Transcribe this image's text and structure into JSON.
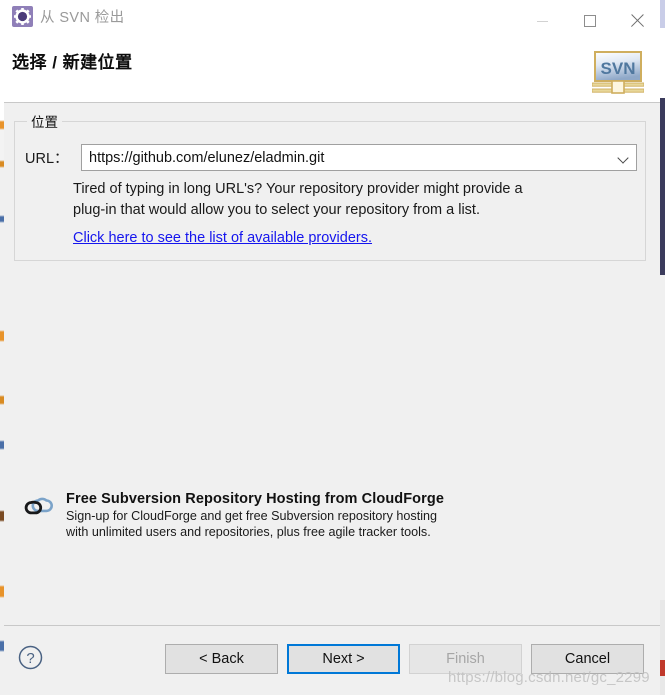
{
  "window": {
    "title": "从 SVN 检出",
    "app_icon": "gear-icon",
    "controls": {
      "minimize": "minimize-icon",
      "maximize": "maximize-icon",
      "close": "close-icon"
    }
  },
  "header": {
    "page_title": "选择 / 新建位置",
    "logo_text": "SVN"
  },
  "location_group": {
    "label": "位置",
    "url_label": "URL：",
    "url_value": "https://github.com/elunez/eladmin.git",
    "url_placeholder": "https://",
    "hint_line1": "Tired of typing in long URL's?  Your repository provider might provide a",
    "hint_line2": "plug-in that would allow you to select your repository from a list.",
    "provider_link": "Click here to see the list of available providers."
  },
  "promo": {
    "icon": "cloud-icon",
    "title": "Free Subversion Repository Hosting from CloudForge",
    "line1": "Sign-up for CloudForge and get free Subversion repository hosting",
    "line2": "with unlimited users and repositories, plus free agile tracker tools."
  },
  "buttonbar": {
    "help": "?",
    "back": "< Back",
    "next": "Next >",
    "finish": "Finish",
    "cancel": "Cancel"
  },
  "watermark": "https://blog.csdn.net/gc_2299",
  "colors": {
    "accent": "#0078d7",
    "link": "#1515ee",
    "body_bg": "#f0f0f0",
    "titlebar_bg": "#ffffff",
    "app_icon_bg": "#8f7fb8",
    "cloud_blue": "#6f9ec7"
  }
}
